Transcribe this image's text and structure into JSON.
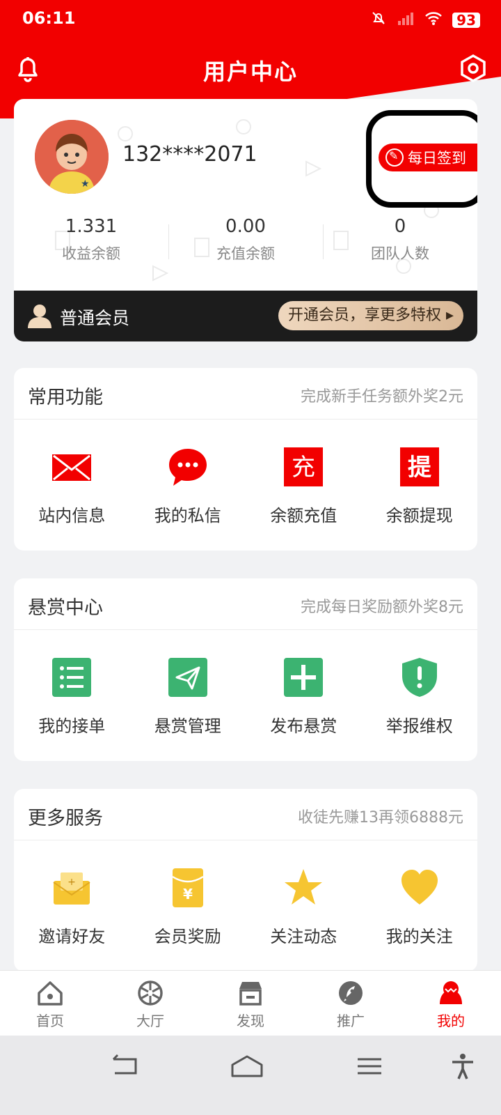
{
  "status_bar": {
    "time": "06:11",
    "battery": "93"
  },
  "header": {
    "title": "用户中心"
  },
  "user": {
    "phone": "132****2071",
    "signin_label": "每日签到",
    "stats": [
      {
        "value": "1.331",
        "label": "收益余额"
      },
      {
        "value": "0.00",
        "label": "充值余额"
      },
      {
        "value": "0",
        "label": "团队人数"
      }
    ],
    "member_level": "普通会员",
    "open_member_label": "开通会员，享更多特权 ▸"
  },
  "sections": [
    {
      "title": "常用功能",
      "subtitle": "完成新手任务额外奖2元",
      "items": [
        {
          "label": "站内信息",
          "icon": "envelope-icon"
        },
        {
          "label": "我的私信",
          "icon": "chat-bubble-icon"
        },
        {
          "label": "余额充值",
          "icon": "recharge-icon",
          "glyph": "充"
        },
        {
          "label": "余额提现",
          "icon": "withdraw-icon",
          "glyph": "提"
        }
      ]
    },
    {
      "title": "悬赏中心",
      "subtitle": "完成每日奖励额外奖8元",
      "items": [
        {
          "label": "我的接单",
          "icon": "list-icon"
        },
        {
          "label": "悬赏管理",
          "icon": "paper-plane-icon"
        },
        {
          "label": "发布悬赏",
          "icon": "plus-icon"
        },
        {
          "label": "举报维权",
          "icon": "shield-alert-icon"
        }
      ]
    },
    {
      "title": "更多服务",
      "subtitle": "收徒先赚13再领6888元",
      "items": [
        {
          "label": "邀请好友",
          "icon": "invite-envelope-icon"
        },
        {
          "label": "会员奖励",
          "icon": "red-packet-icon"
        },
        {
          "label": "关注动态",
          "icon": "star-icon"
        },
        {
          "label": "我的关注",
          "icon": "heart-icon"
        }
      ]
    }
  ],
  "tabs": [
    {
      "label": "首页",
      "icon": "home-icon"
    },
    {
      "label": "大厅",
      "icon": "aperture-icon"
    },
    {
      "label": "发现",
      "icon": "store-icon"
    },
    {
      "label": "推广",
      "icon": "rocket-icon"
    },
    {
      "label": "我的",
      "icon": "profile-icon",
      "active": true
    }
  ],
  "colors": {
    "accent": "#f20000",
    "green": "#3cb371",
    "yellow": "#f6c531"
  }
}
